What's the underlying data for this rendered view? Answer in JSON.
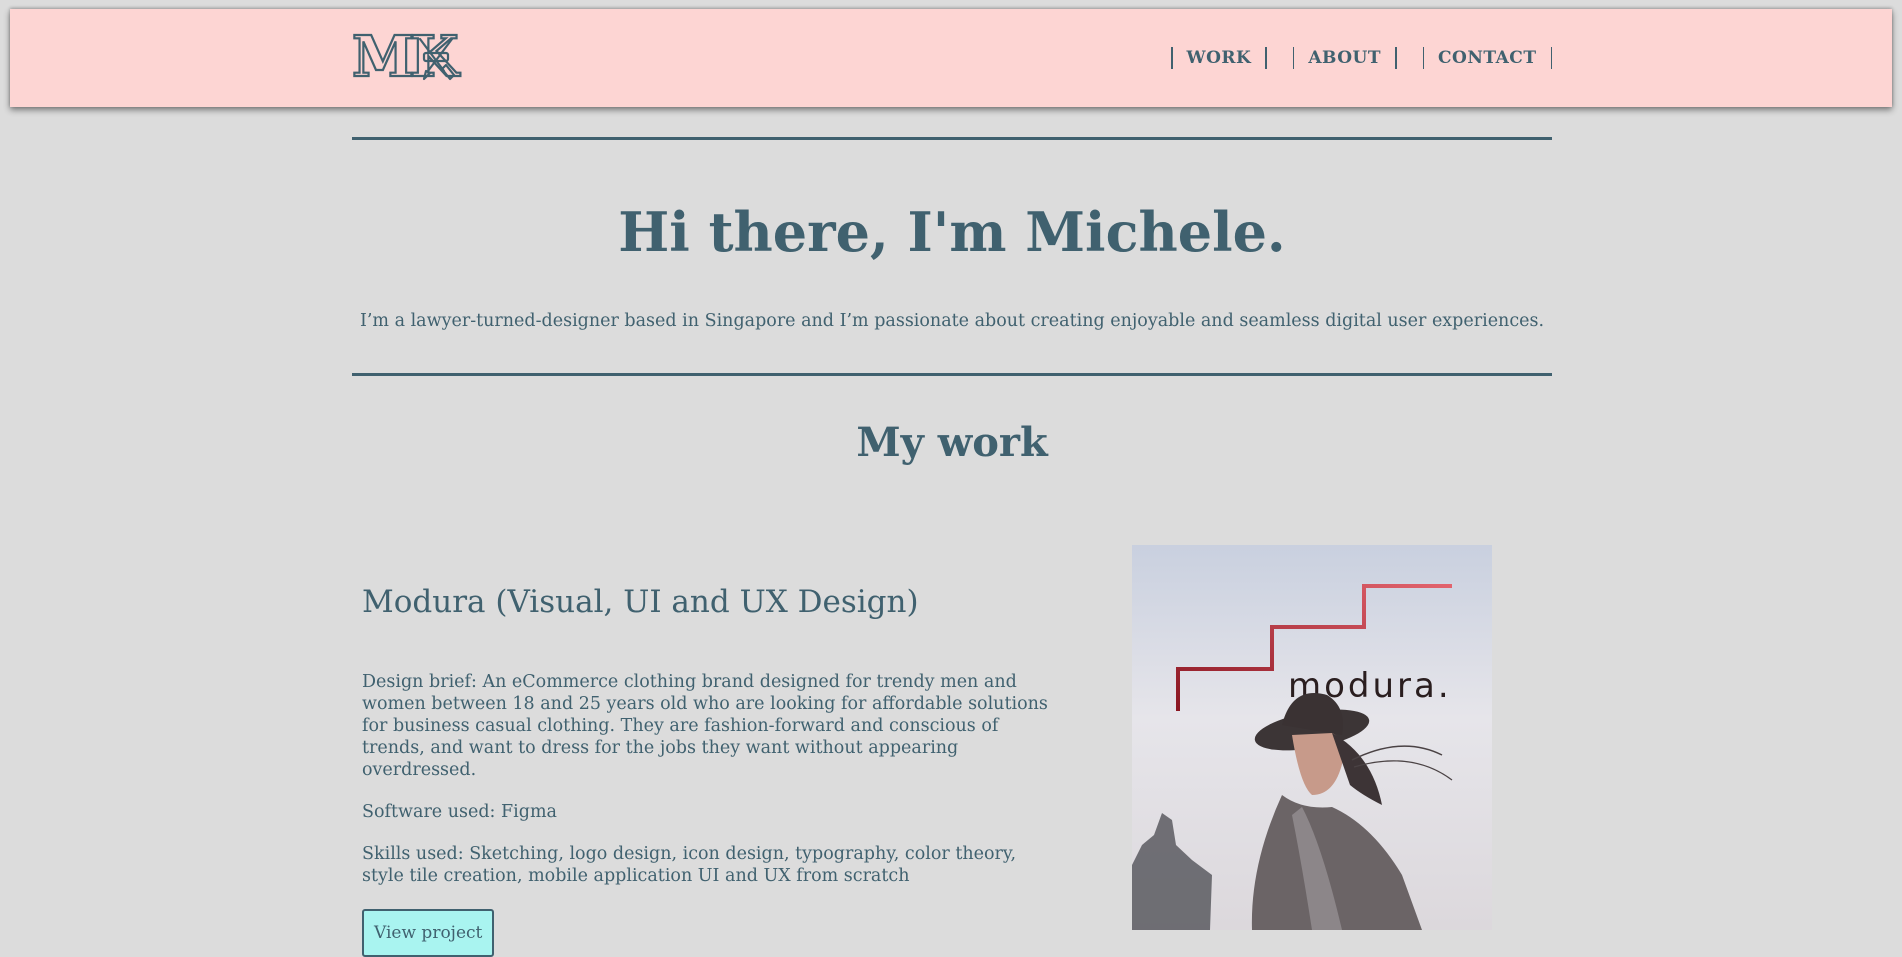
{
  "header": {
    "logo_text": "MK",
    "nav": [
      {
        "label": "WORK"
      },
      {
        "label": "ABOUT"
      },
      {
        "label": "CONTACT"
      }
    ]
  },
  "hero": {
    "title": "Hi there, I'm Michele.",
    "subtitle": "I’m a lawyer-turned-designer based in Singapore and I’m passionate about creating enjoyable and seamless digital user experiences."
  },
  "work": {
    "title": "My work",
    "projects": [
      {
        "title": "Modura (Visual, UI and UX Design)",
        "brief": "Design brief: An eCommerce clothing brand designed for trendy men and women between 18 and 25 years old who are looking for affordable solutions for business casual clothing. They are fashion-forward and conscious of trends, and want to dress for the jobs they want without appearing overdressed.",
        "software": "Software used: Figma",
        "skills": "Skills used: Sketching, logo design, icon design, typography, color theory, style tile creation, mobile application UI and UX from scratch",
        "button_label": "View project",
        "image_brand_text": "modura."
      }
    ]
  },
  "colors": {
    "background": "#dcdcdc",
    "header_bg": "#fdd5d3",
    "primary_text": "#40616f",
    "button_bg": "#a9f4f0"
  }
}
